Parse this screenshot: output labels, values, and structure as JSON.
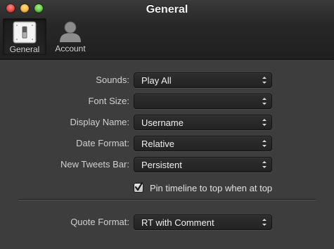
{
  "window": {
    "title": "General"
  },
  "toolbar": {
    "items": [
      {
        "label": "General",
        "icon": "switch-icon",
        "selected": true
      },
      {
        "label": "Account",
        "icon": "person-icon",
        "selected": false
      }
    ]
  },
  "settings": {
    "sounds": {
      "label": "Sounds:",
      "value": "Play All"
    },
    "font_size": {
      "label": "Font Size:",
      "value": ""
    },
    "display_name": {
      "label": "Display Name:",
      "value": "Username"
    },
    "date_format": {
      "label": "Date Format:",
      "value": "Relative"
    },
    "new_tweets_bar": {
      "label": "New Tweets Bar:",
      "value": "Persistent"
    },
    "pin_timeline": {
      "label": "Pin timeline to top when at top",
      "checked": true
    },
    "quote_format": {
      "label": "Quote Format:",
      "value": "RT with Comment"
    }
  },
  "colors": {
    "window_bg": "#3d3d3d",
    "titlebar_bg": "#262626",
    "close": "#e0443e",
    "minimize": "#f0b43a",
    "maximize": "#5fc43f"
  }
}
